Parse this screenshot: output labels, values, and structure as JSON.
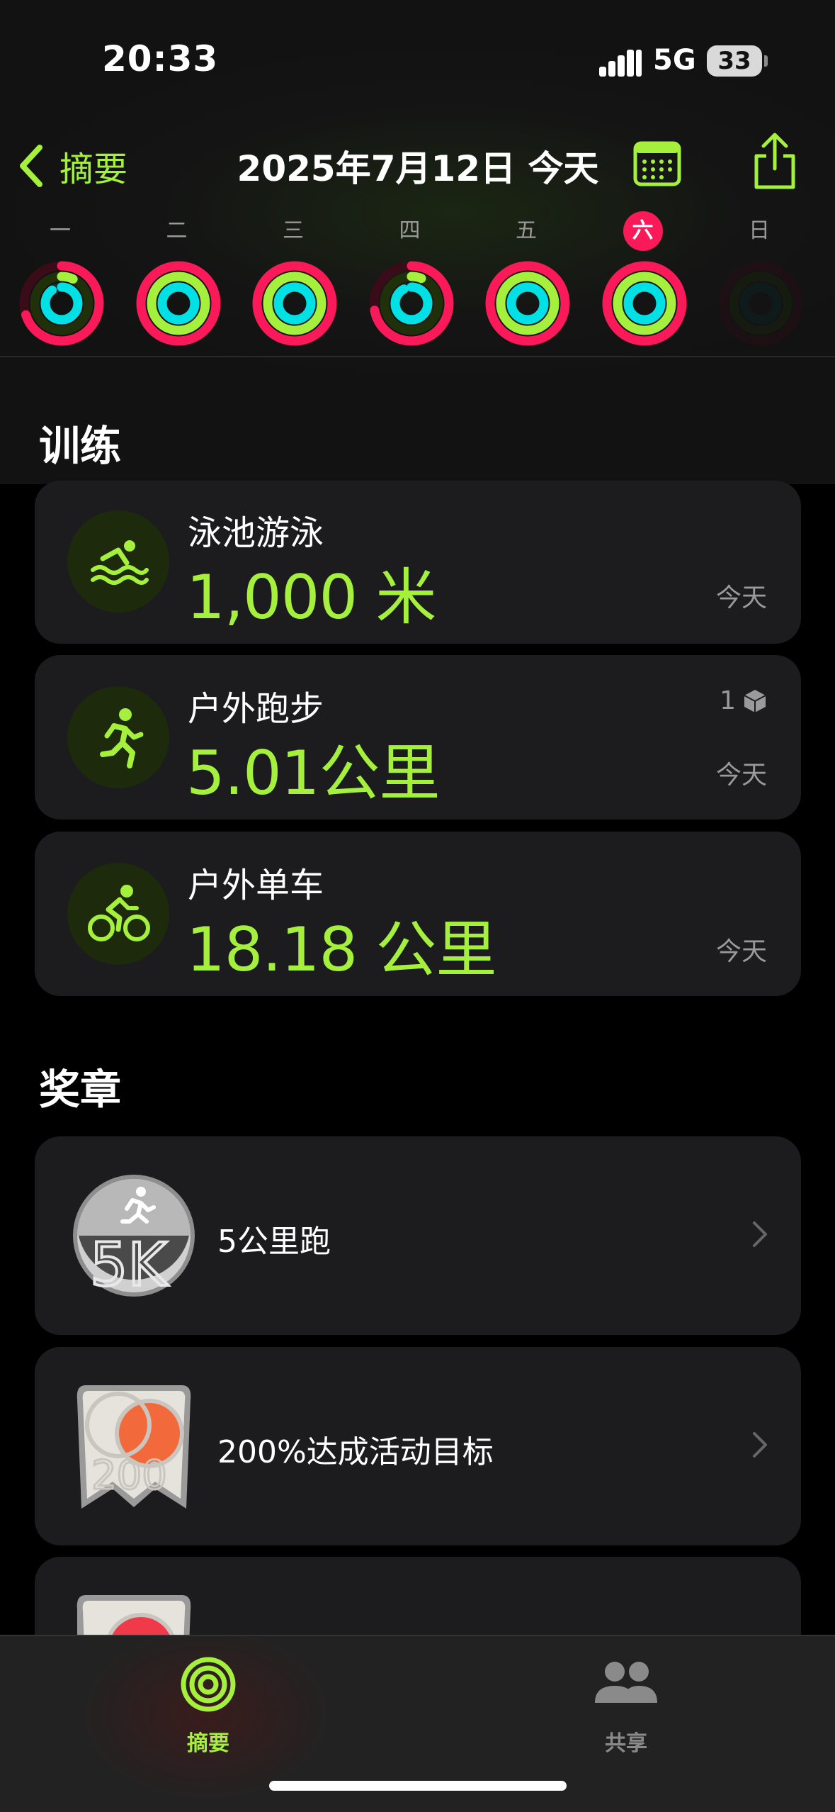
{
  "status": {
    "time": "20:33",
    "network": "5G",
    "battery": "33"
  },
  "nav": {
    "back_label": "摘要",
    "title": "2025年7月12日 今天"
  },
  "week": {
    "days": [
      {
        "label": "一",
        "move": 0.7,
        "exercise": 0.07,
        "stand": 0.9
      },
      {
        "label": "二",
        "move": 1.0,
        "exercise": 1.0,
        "stand": 1.0
      },
      {
        "label": "三",
        "move": 1.0,
        "exercise": 1.0,
        "stand": 1.0
      },
      {
        "label": "四",
        "move": 0.72,
        "exercise": 0.06,
        "stand": 0.92
      },
      {
        "label": "五",
        "move": 1.0,
        "exercise": 1.0,
        "stand": 1.0
      },
      {
        "label": "六",
        "move": 1.0,
        "exercise": 1.0,
        "stand": 1.0
      },
      {
        "label": "日",
        "move": 0.0,
        "exercise": 0.0,
        "stand": 0.0
      }
    ],
    "selected_index": 5
  },
  "workouts": {
    "title": "训练",
    "items": [
      {
        "name": "泳池游泳",
        "value": "1,000 米",
        "date": "今天",
        "icon": "swimming-icon"
      },
      {
        "name": "户外跑步",
        "value": "5.01公里",
        "date": "今天",
        "count": "1",
        "icon": "running-icon"
      },
      {
        "name": "户外单车",
        "value": "18.18 公里",
        "date": "今天",
        "icon": "cycling-icon"
      }
    ]
  },
  "awards": {
    "title": "奖章",
    "items": [
      {
        "label": "5公里跑",
        "badge_text": "5K",
        "icon": "5k-run-medal"
      },
      {
        "label": "200%达成活动目标",
        "badge_text": "200",
        "icon": "200-percent-move-medal"
      }
    ]
  },
  "tabs": [
    {
      "label": "摘要",
      "active": true,
      "icon": "activity-rings-icon"
    },
    {
      "label": "共享",
      "active": false,
      "icon": "people-icon"
    }
  ],
  "colors": {
    "accent_green": "#a4f03c",
    "move_red": "#fa1a5a",
    "exercise_green": "#a4f03c",
    "stand_cyan": "#00e0e5",
    "card_bg": "#1c1c1e"
  }
}
